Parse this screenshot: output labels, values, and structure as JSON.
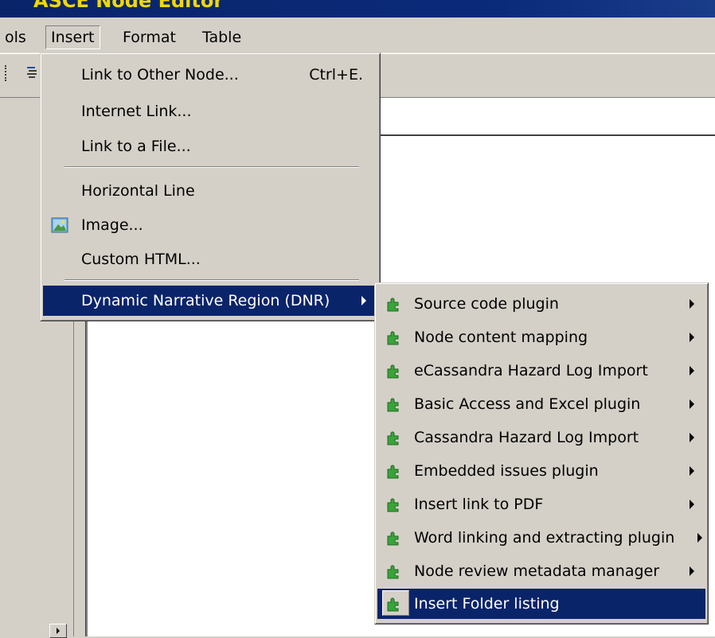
{
  "window": {
    "title": "ASCE Node Editor"
  },
  "menubar": {
    "items": [
      {
        "label": "ols",
        "active": false
      },
      {
        "label": "Insert",
        "active": true
      },
      {
        "label": "Format",
        "active": false
      },
      {
        "label": "Table",
        "active": false
      }
    ]
  },
  "insert_menu": {
    "items": [
      {
        "label": "Link to Other Node...",
        "shortcut": "Ctrl+E."
      },
      {
        "label": "Internet Link..."
      },
      {
        "label": "Link to a File..."
      },
      {
        "label": "Horizontal Line"
      },
      {
        "label": "Image...",
        "icon": "image-icon"
      },
      {
        "label": "Custom HTML..."
      },
      {
        "label": "Dynamic Narrative Region (DNR)",
        "submenu": true,
        "highlighted": true
      }
    ]
  },
  "dnr_submenu": {
    "items": [
      {
        "label": "Source code plugin",
        "submenu": true
      },
      {
        "label": "Node content mapping",
        "submenu": true
      },
      {
        "label": "eCassandra Hazard Log Import",
        "submenu": true
      },
      {
        "label": "Basic Access and Excel plugin",
        "submenu": true
      },
      {
        "label": "Cassandra Hazard Log Import",
        "submenu": true
      },
      {
        "label": "Embedded issues plugin",
        "submenu": true
      },
      {
        "label": "Insert link to PDF",
        "submenu": true
      },
      {
        "label": "Word linking and extracting plugin",
        "submenu": true
      },
      {
        "label": "Node review metadata manager",
        "submenu": true
      },
      {
        "label": "Insert Folder listing",
        "submenu": false,
        "highlighted": true
      }
    ],
    "icon": "puzzle-plugin-icon"
  },
  "colors": {
    "highlight": "#0a246a",
    "title_text": "#f1d800",
    "face": "#d4d0c8"
  }
}
